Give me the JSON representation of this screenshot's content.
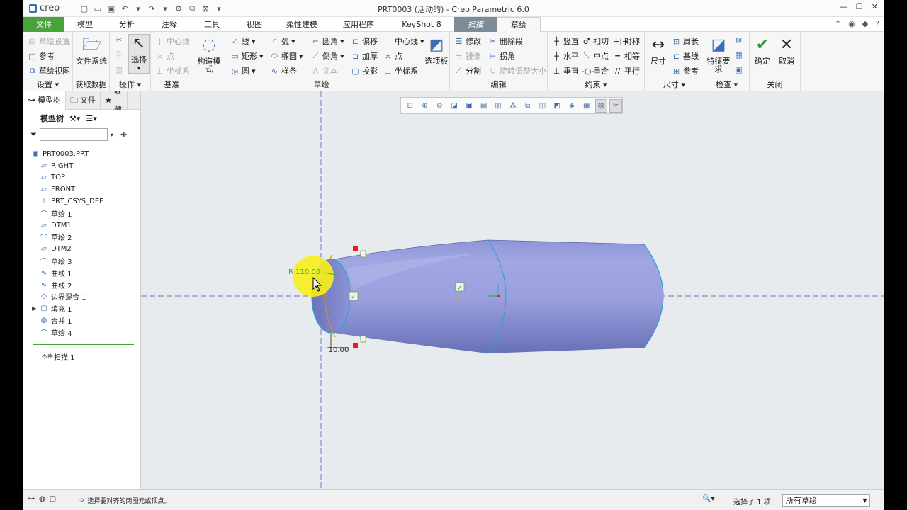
{
  "titlebar": {
    "logo": "creo",
    "title": "PRT0003 (活动的) - Creo Parametric 6.0"
  },
  "tabs": [
    {
      "label": "文件"
    },
    {
      "label": "模型"
    },
    {
      "label": "分析"
    },
    {
      "label": "注释"
    },
    {
      "label": "工具"
    },
    {
      "label": "视图"
    },
    {
      "label": "柔性建模"
    },
    {
      "label": "应用程序"
    },
    {
      "label": "KeyShot 8"
    },
    {
      "label": "扫描"
    },
    {
      "label": "草绘"
    }
  ],
  "ribbon": {
    "setup": {
      "items": [
        "草绘设置",
        "参考",
        "草绘视图"
      ],
      "label": "设置"
    },
    "get_data": {
      "file_system": "文件系统",
      "label": "获取数据"
    },
    "operations": {
      "select": "选择",
      "label": "操作"
    },
    "datum": {
      "items": [
        "中心线",
        "点",
        "坐标系"
      ],
      "label": "基准"
    },
    "sketching": {
      "construction_mode": "构造模式",
      "col1": [
        "线",
        "矩形",
        "圆"
      ],
      "col2": [
        "弧",
        "椭圆",
        "样条"
      ],
      "col3": [
        "圆角",
        "倒角",
        "文本"
      ],
      "col4": [
        "偏移",
        "加厚",
        "投影"
      ],
      "col5": [
        "中心线",
        "点",
        "坐标系"
      ],
      "palette": "选项板",
      "label": "草绘"
    },
    "editing": {
      "col1": [
        "修改",
        "镜像",
        "分割"
      ],
      "col2": [
        "删除段",
        "拐角",
        "旋转调整大小"
      ],
      "label": "编辑"
    },
    "constrain": {
      "col1": [
        "竖直",
        "水平",
        "垂直"
      ],
      "col2": [
        "相切",
        "中点",
        "重合"
      ],
      "col3": [
        "对称",
        "相等",
        "平行"
      ],
      "label": "约束"
    },
    "dimension": {
      "dimension": "尺寸",
      "items": [
        "周长",
        "基线",
        "参考"
      ],
      "label": "尺寸"
    },
    "inspect": {
      "feature_req": "特征要求",
      "label": "检查"
    },
    "close": {
      "ok": "确定",
      "cancel": "取消",
      "label": "关闭"
    }
  },
  "left_panel": {
    "tabs": [
      "模型树",
      "文件",
      "收藏"
    ],
    "tree_title": "模型树",
    "search_value": "",
    "tree_items": [
      {
        "label": "PRT0003.PRT",
        "icon": "part-icon",
        "level": 0
      },
      {
        "label": "RIGHT",
        "icon": "datum-plane-icon",
        "level": 1
      },
      {
        "label": "TOP",
        "icon": "datum-plane-icon",
        "level": 1
      },
      {
        "label": "FRONT",
        "icon": "datum-plane-icon",
        "level": 1
      },
      {
        "label": "PRT_CSYS_DEF",
        "icon": "csys-icon",
        "level": 1
      },
      {
        "label": "草绘 1",
        "icon": "sketch-icon",
        "level": 1
      },
      {
        "label": "DTM1",
        "icon": "datum-plane-icon",
        "level": 1
      },
      {
        "label": "草绘 2",
        "icon": "sketch-icon",
        "level": 1
      },
      {
        "label": "DTM2",
        "icon": "datum-plane-icon",
        "level": 1
      },
      {
        "label": "草绘 3",
        "icon": "sketch-icon",
        "level": 1
      },
      {
        "label": "曲线 1",
        "icon": "curve-icon",
        "level": 1
      },
      {
        "label": "曲线 2",
        "icon": "curve-icon",
        "level": 1
      },
      {
        "label": "边界混合 1",
        "icon": "boundary-blend-icon",
        "level": 1
      },
      {
        "label": "填充 1",
        "icon": "fill-icon",
        "level": 1,
        "expandable": true
      },
      {
        "label": "合并 1",
        "icon": "merge-icon",
        "level": 1
      },
      {
        "label": "草绘 4",
        "icon": "sketch-icon",
        "level": 1
      }
    ],
    "insert_items": [
      {
        "label": "扫描 1",
        "icon": "sweep-icon"
      }
    ]
  },
  "graphics": {
    "dimension_radius": "R 110.00",
    "dimension_linear": "10.00"
  },
  "status": {
    "message": "选择要对齐的两图元或顶点。",
    "selection_count": "选择了 1 项",
    "filter_value": "所有草绘"
  },
  "colors": {
    "file_tab": "#48a23a",
    "context_tab": "#7d8b96",
    "surface": "#8c93d4",
    "centerline": "#7a73c8",
    "edge": "#2e9fd8",
    "dimension": "#33b233",
    "highlight_circle": "#f7ef1a",
    "constraint_marker": "#e81c1c"
  }
}
